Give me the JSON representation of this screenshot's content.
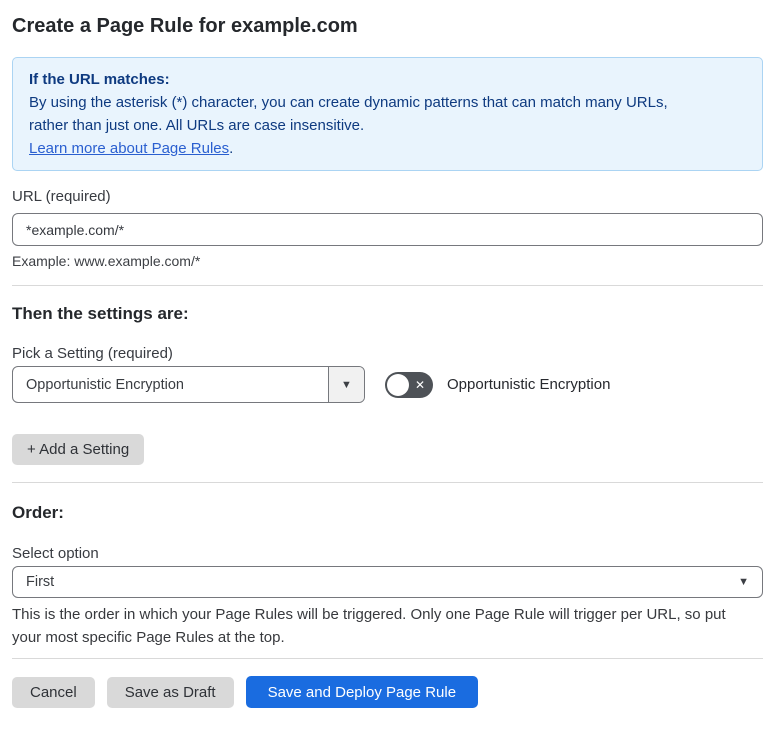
{
  "page": {
    "title": "Create a Page Rule for example.com"
  },
  "info_box": {
    "heading": "If the URL matches:",
    "body_line1": "By using the asterisk (*) character, you can create dynamic patterns that can match many URLs,",
    "body_line2": "rather than just one. All URLs are case insensitive.",
    "link_label": "Learn more about Page Rules",
    "link_suffix": "."
  },
  "url_field": {
    "label": "URL (required)",
    "value": "*example.com/*",
    "helper": "Example: www.example.com/*"
  },
  "settings_section": {
    "heading": "Then the settings are:",
    "picker_label": "Pick a Setting (required)",
    "picker_value": "Opportunistic Encryption",
    "dropdown_icon": "▼",
    "toggle_state": "off",
    "toggle_icon": "✕",
    "toggle_label": "Opportunistic Encryption",
    "add_button_label": "+ Add a Setting"
  },
  "order_section": {
    "heading": "Order:",
    "select_label": "Select option",
    "select_value": "First",
    "dropdown_icon": "▼",
    "helper": "This is the order in which your Page Rules will be triggered. Only one Page Rule will trigger per URL, so put your most specific Page Rules at the top."
  },
  "footer": {
    "cancel_label": "Cancel",
    "save_draft_label": "Save as Draft",
    "save_deploy_label": "Save and Deploy Page Rule"
  },
  "colors": {
    "accent_blue": "#1a6ce0",
    "info_box_bg": "#e9f4fd",
    "info_box_border": "#abd4f3",
    "info_box_text": "#0e3a80",
    "link_blue": "#2a5fd0",
    "gray_button_bg": "#d9d9d9",
    "toggle_off_bg": "#4e5257"
  }
}
